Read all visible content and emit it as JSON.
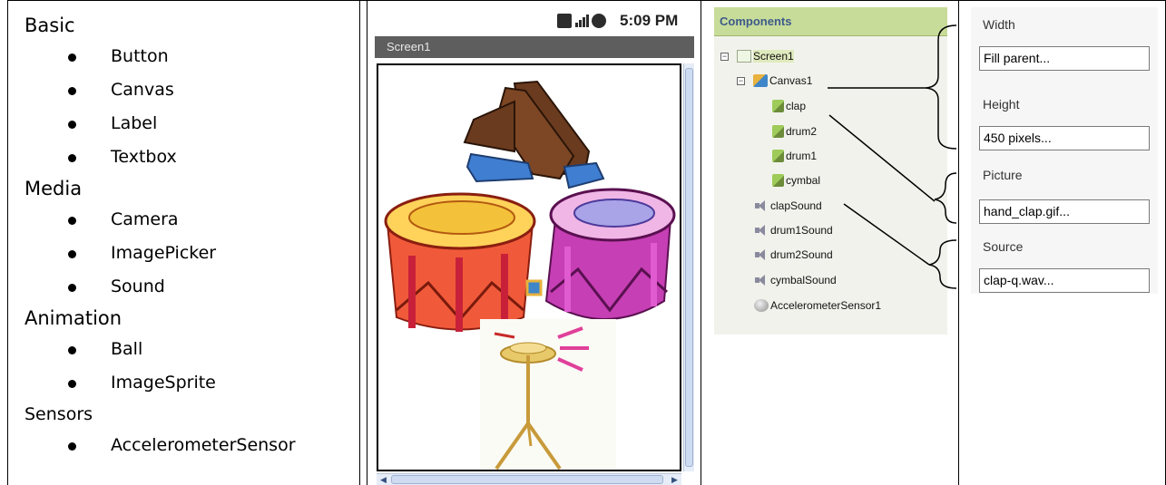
{
  "palette": {
    "categories": [
      {
        "name": "Basic",
        "items": [
          "Button",
          "Canvas",
          "Label",
          "Textbox"
        ]
      },
      {
        "name": "Media",
        "items": [
          "Camera",
          "ImagePicker",
          "Sound"
        ]
      },
      {
        "name": "Animation",
        "items": [
          "Ball",
          "ImageSprite"
        ]
      },
      {
        "name": "Sensors",
        "items": [
          "AccelerometerSensor"
        ]
      }
    ]
  },
  "phone": {
    "clock": "5:09 PM",
    "screen_title": "Screen1"
  },
  "components": {
    "header": "Components",
    "tree": {
      "screen": "Screen1",
      "canvas": "Canvas1",
      "sprites": [
        "clap",
        "drum2",
        "drum1",
        "cymbal"
      ],
      "sounds": [
        "clapSound",
        "drum1Sound",
        "drum2Sound",
        "cymbalSound"
      ],
      "sensor": "AccelerometerSensor1"
    }
  },
  "properties": {
    "width": {
      "label": "Width",
      "value": "Fill parent..."
    },
    "height": {
      "label": "Height",
      "value": "450 pixels..."
    },
    "picture": {
      "label": "Picture",
      "value": "hand_clap.gif..."
    },
    "source": {
      "label": "Source",
      "value": "clap-q.wav..."
    }
  },
  "colors": {
    "components_header_bg": "#c8dc9a",
    "components_header_text": "#3d5a8a",
    "phone_titlebar": "#5e5e5e",
    "bracket": "#000000"
  }
}
